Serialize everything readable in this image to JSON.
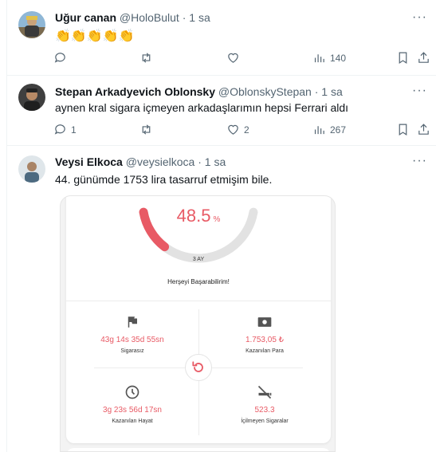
{
  "tweets": [
    {
      "name": "Uğur canan",
      "handle": "@HoloBulut",
      "dot": "·",
      "time": "1 sa",
      "text": "👏👏👏👏👏",
      "more": "···",
      "stats": {
        "replies": "",
        "retweets": "",
        "likes": "",
        "views": "140"
      }
    },
    {
      "name": "Stepan Arkadyevich Oblonsky",
      "handle": "@OblonskyStepan",
      "dot": "·",
      "time": "1 sa",
      "text": "aynen kral sigara içmeyen arkadaşlarımın hepsi Ferrari aldı",
      "more": "···",
      "stats": {
        "replies": "1",
        "retweets": "",
        "likes": "2",
        "views": "267"
      }
    },
    {
      "name": "Veysi Elkoca",
      "handle": "@veysielkoca",
      "dot": "·",
      "time": "1 sa",
      "text": "44. günümde 1753 lira tasarruf etmişim bile.",
      "more": "···"
    }
  ],
  "app_card": {
    "progress_value": "48.5",
    "progress_unit": "%",
    "progress_fraction": 0.485,
    "period": "3 AY",
    "motto": "Herşeyi Başarabilirim!",
    "accent_color": "#e85a65",
    "stats": [
      {
        "icon": "flag-icon",
        "value": "43g 14s 35d 55sn",
        "label": "Sigarasız"
      },
      {
        "icon": "money-icon",
        "value": "1.753,05 ₺",
        "label": "Kazanılan Para"
      },
      {
        "icon": "clock-icon",
        "value": "3g 23s 56d 17sn",
        "label": "Kazanılan Hayat"
      },
      {
        "icon": "no-smoking-icon",
        "value": "523.3",
        "label": "İçilmeyen Sigaralar"
      }
    ]
  }
}
